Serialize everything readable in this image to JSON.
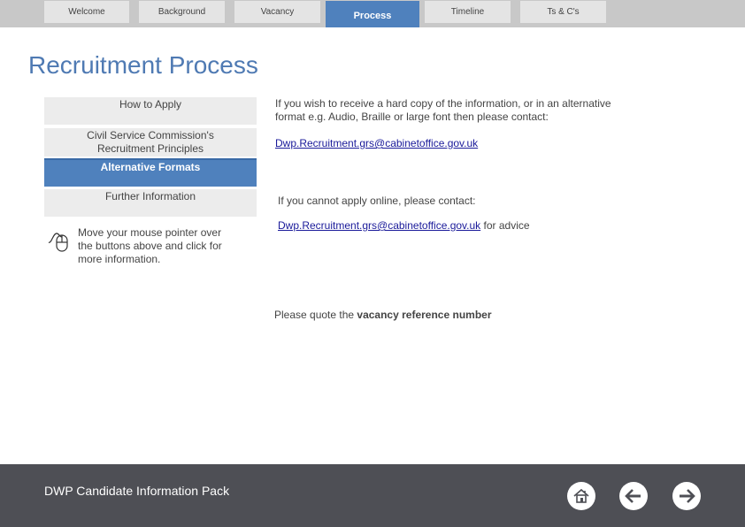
{
  "nav": {
    "tabs": [
      {
        "label": "Welcome",
        "active": false
      },
      {
        "label": "Background",
        "active": false
      },
      {
        "label": "Vacancy",
        "active": false
      },
      {
        "label": "Process",
        "active": true
      },
      {
        "label": "Timeline",
        "active": false
      },
      {
        "label": "Ts & C's",
        "active": false
      }
    ]
  },
  "page": {
    "title": "Recruitment Process"
  },
  "side_menu": {
    "items": [
      {
        "label": "How to Apply",
        "active": false
      },
      {
        "label": "Civil Service Commission's Recruitment Principles",
        "active": false
      },
      {
        "label": "Alternative Formats",
        "active": true
      },
      {
        "label": "Further Information",
        "active": false
      }
    ],
    "hint": "Move your mouse pointer over the buttons above and click for more information.",
    "hint_icon": "mouse-icon"
  },
  "content": {
    "para1": "If you wish to receive a hard copy of the information, or in an alternative format e.g. Audio, Braille or large font then please contact:",
    "email1": "Dwp.Recruitment.grs@cabinetoffice.gov.uk",
    "para2": "If you cannot apply online, please contact:",
    "email2": "Dwp.Recruitment.grs@cabinetoffice.gov.uk",
    "email2_suffix": " for advice",
    "quote_prefix": "Please quote the ",
    "quote_bold": "vacancy reference number"
  },
  "footer": {
    "title": "DWP Candidate Information Pack",
    "buttons": [
      {
        "icon": "home-icon"
      },
      {
        "icon": "arrow-left-icon"
      },
      {
        "icon": "arrow-right-icon"
      }
    ]
  },
  "colors": {
    "accent": "#4f81bd",
    "title": "#4f7ab3",
    "footer": "#4e4f55",
    "tab_bg": "#e4e4e4",
    "bar_bg": "#c8c8c8"
  }
}
